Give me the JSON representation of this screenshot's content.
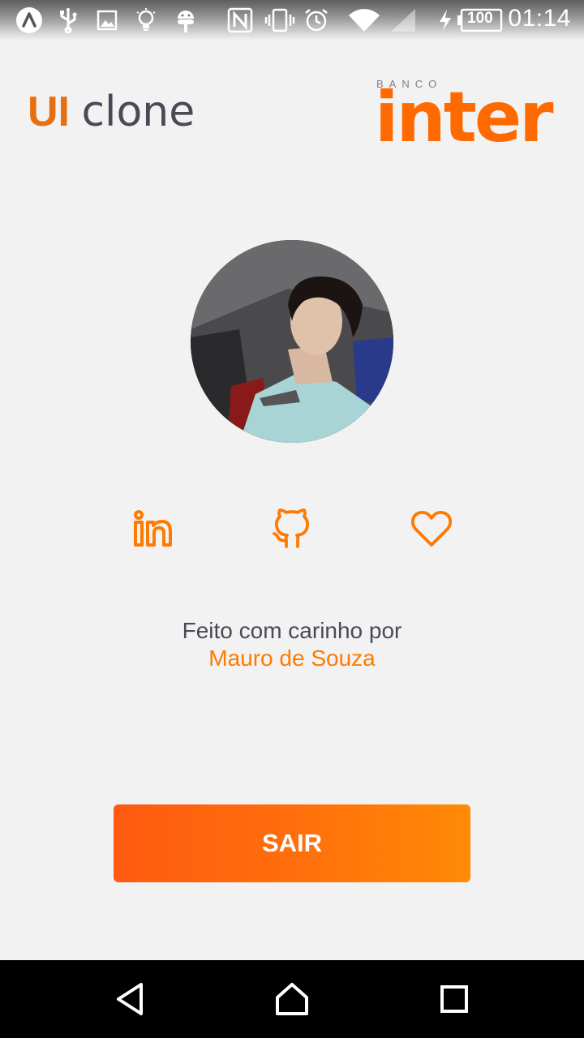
{
  "status_bar": {
    "battery_level": "100",
    "time": "01:14"
  },
  "header": {
    "title_prefix": "UI",
    "title_suffix": "clone",
    "brand_small": "BANCO",
    "brand_large": "inter"
  },
  "social": {
    "linkedin_icon": "linkedin-icon",
    "github_icon": "github-icon",
    "heart_icon": "heart-icon"
  },
  "credits": {
    "line1": "Feito com carinho por",
    "author": "Mauro de Souza"
  },
  "actions": {
    "logout_label": "SAIR"
  },
  "colors": {
    "accent": "#ff7a00",
    "button_start": "#ff5a10",
    "button_end": "#ff8a05",
    "text": "#4a4a57",
    "background": "#f2f2f2"
  }
}
